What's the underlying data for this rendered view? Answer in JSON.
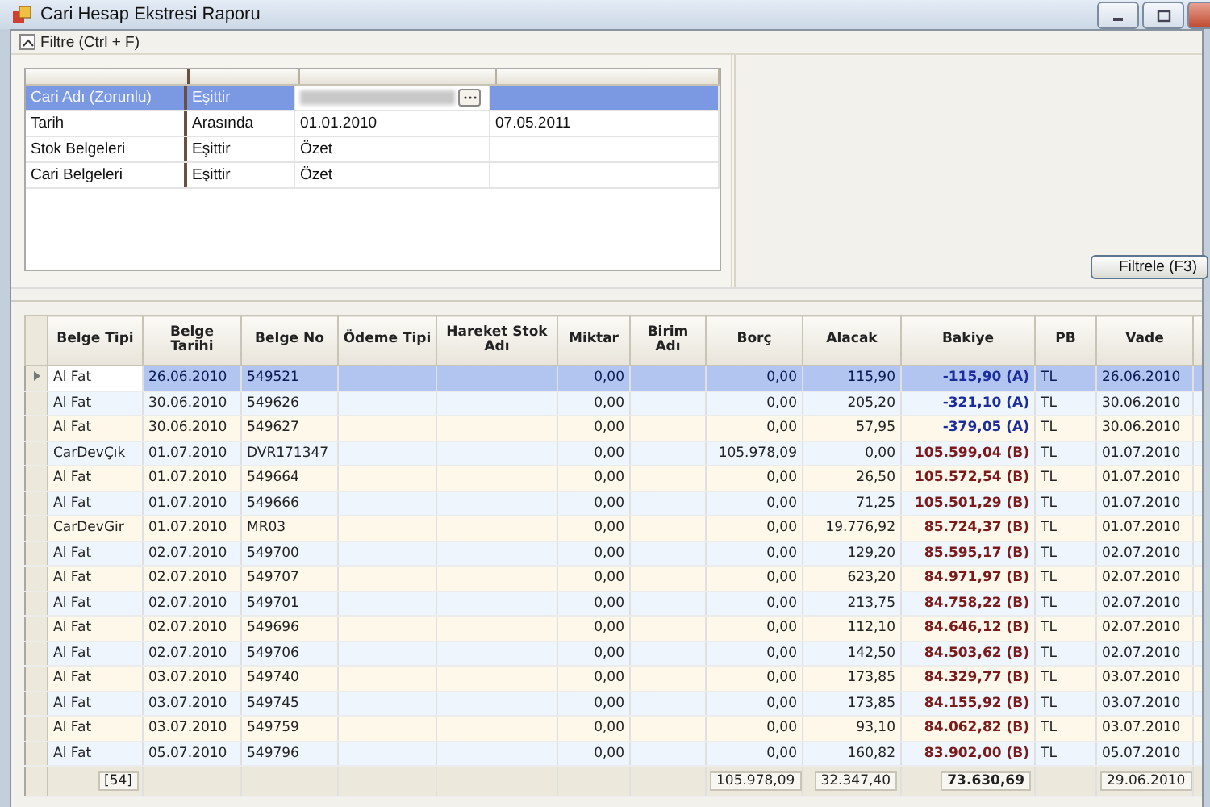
{
  "window": {
    "title": "Cari Hesap Ekstresi Raporu"
  },
  "filter_panel": {
    "title": "Filtre (Ctrl + F)",
    "expanded": true,
    "rows": [
      {
        "field": "Cari Adı (Zorunlu)",
        "operator": "Eşittir",
        "value_redacted": true,
        "value": "",
        "value2": "",
        "selected": true
      },
      {
        "field": "Tarih",
        "operator": "Arasında",
        "value_redacted": false,
        "value": "01.01.2010",
        "value2": "07.05.2011",
        "selected": false
      },
      {
        "field": "Stok Belgeleri",
        "operator": "Eşittir",
        "value_redacted": false,
        "value": "Özet",
        "value2": "",
        "selected": false
      },
      {
        "field": "Cari Belgeleri",
        "operator": "Eşittir",
        "value_redacted": false,
        "value": "Özet",
        "value2": "",
        "selected": false
      }
    ],
    "filter_button": "Filtrele (F3)"
  },
  "table": {
    "columns": [
      "Belge Tipi",
      "Belge Tarihi",
      "Belge No",
      "Ödeme Tipi",
      "Hareket Stok Adı",
      "Miktar",
      "Birim Adı",
      "Borç",
      "Alacak",
      "Bakiye",
      "PB",
      "Vade"
    ],
    "rows": [
      {
        "selected": true,
        "cells": [
          "Al Fat",
          "26.06.2010",
          "549521",
          "",
          "",
          "0,00",
          "",
          "0,00",
          "115,90",
          "-115,90 (A)",
          "TL",
          "26.06.2010"
        ],
        "color": "#1c2c9c"
      },
      {
        "selected": false,
        "cells": [
          "Al Fat",
          "30.06.2010",
          "549626",
          "",
          "",
          "0,00",
          "",
          "0,00",
          "205,20",
          "-321,10 (A)",
          "TL",
          "30.06.2010"
        ],
        "color": "#1c2c9c"
      },
      {
        "selected": false,
        "cells": [
          "Al Fat",
          "30.06.2010",
          "549627",
          "",
          "",
          "0,00",
          "",
          "0,00",
          "57,95",
          "-379,05 (A)",
          "TL",
          "30.06.2010"
        ],
        "color": "#1c2c9c"
      },
      {
        "selected": false,
        "cells": [
          "CarDevÇık",
          "01.07.2010",
          "DVR171347",
          "",
          "",
          "0,00",
          "",
          "105.978,09",
          "0,00",
          "105.599,04 (B)",
          "TL",
          "01.07.2010"
        ],
        "color": "#7a1a1a"
      },
      {
        "selected": false,
        "cells": [
          "Al Fat",
          "01.07.2010",
          "549664",
          "",
          "",
          "0,00",
          "",
          "0,00",
          "26,50",
          "105.572,54 (B)",
          "TL",
          "01.07.2010"
        ],
        "color": "#7a1a1a"
      },
      {
        "selected": false,
        "cells": [
          "Al Fat",
          "01.07.2010",
          "549666",
          "",
          "",
          "0,00",
          "",
          "0,00",
          "71,25",
          "105.501,29 (B)",
          "TL",
          "01.07.2010"
        ],
        "color": "#7a1a1a"
      },
      {
        "selected": false,
        "cells": [
          "CarDevGir",
          "01.07.2010",
          "MR03",
          "",
          "",
          "0,00",
          "",
          "0,00",
          "19.776,92",
          "85.724,37 (B)",
          "TL",
          "01.07.2010"
        ],
        "color": "#7a1a1a"
      },
      {
        "selected": false,
        "cells": [
          "Al Fat",
          "02.07.2010",
          "549700",
          "",
          "",
          "0,00",
          "",
          "0,00",
          "129,20",
          "85.595,17 (B)",
          "TL",
          "02.07.2010"
        ],
        "color": "#7a1a1a"
      },
      {
        "selected": false,
        "cells": [
          "Al Fat",
          "02.07.2010",
          "549707",
          "",
          "",
          "0,00",
          "",
          "0,00",
          "623,20",
          "84.971,97 (B)",
          "TL",
          "02.07.2010"
        ],
        "color": "#7a1a1a"
      },
      {
        "selected": false,
        "cells": [
          "Al Fat",
          "02.07.2010",
          "549701",
          "",
          "",
          "0,00",
          "",
          "0,00",
          "213,75",
          "84.758,22 (B)",
          "TL",
          "02.07.2010"
        ],
        "color": "#7a1a1a"
      },
      {
        "selected": false,
        "cells": [
          "Al Fat",
          "02.07.2010",
          "549696",
          "",
          "",
          "0,00",
          "",
          "0,00",
          "112,10",
          "84.646,12 (B)",
          "TL",
          "02.07.2010"
        ],
        "color": "#7a1a1a"
      },
      {
        "selected": false,
        "cells": [
          "Al Fat",
          "02.07.2010",
          "549706",
          "",
          "",
          "0,00",
          "",
          "0,00",
          "142,50",
          "84.503,62 (B)",
          "TL",
          "02.07.2010"
        ],
        "color": "#7a1a1a"
      },
      {
        "selected": false,
        "cells": [
          "Al Fat",
          "03.07.2010",
          "549740",
          "",
          "",
          "0,00",
          "",
          "0,00",
          "173,85",
          "84.329,77 (B)",
          "TL",
          "03.07.2010"
        ],
        "color": "#7a1a1a"
      },
      {
        "selected": false,
        "cells": [
          "Al Fat",
          "03.07.2010",
          "549745",
          "",
          "",
          "0,00",
          "",
          "0,00",
          "173,85",
          "84.155,92 (B)",
          "TL",
          "03.07.2010"
        ],
        "color": "#7a1a1a"
      },
      {
        "selected": false,
        "cells": [
          "Al Fat",
          "03.07.2010",
          "549759",
          "",
          "",
          "0,00",
          "",
          "0,00",
          "93,10",
          "84.062,82 (B)",
          "TL",
          "03.07.2010"
        ],
        "color": "#7a1a1a"
      },
      {
        "selected": false,
        "cells": [
          "Al Fat",
          "05.07.2010",
          "549796",
          "",
          "",
          "0,00",
          "",
          "0,00",
          "160,82",
          "83.902,00 (B)",
          "TL",
          "05.07.2010"
        ],
        "color": "#7a1a1a"
      }
    ],
    "footer": {
      "count": "[54]",
      "borc": "105.978,09",
      "alacak": "32.347,40",
      "bakiye": "73.630,69",
      "vade": "29.06.2010"
    }
  }
}
